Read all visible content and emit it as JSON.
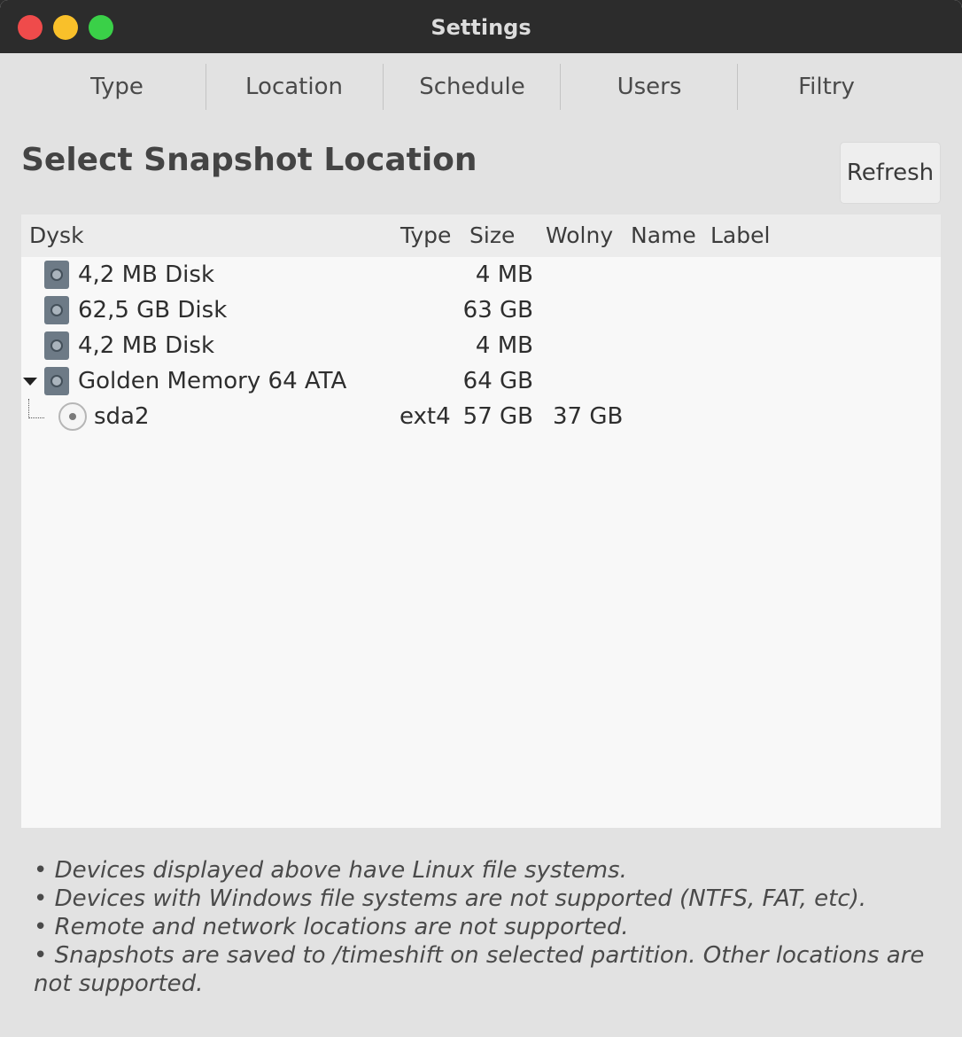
{
  "window": {
    "title": "Settings"
  },
  "tabs": [
    {
      "label": "Type"
    },
    {
      "label": "Location"
    },
    {
      "label": "Schedule"
    },
    {
      "label": "Users"
    },
    {
      "label": "Filtry"
    }
  ],
  "heading": "Select Snapshot Location",
  "refresh_label": "Refresh",
  "table": {
    "columns": {
      "disk": "Dysk",
      "type": "Type",
      "size": "Size",
      "free": "Wolny",
      "name": "Name",
      "label": "Label"
    },
    "rows": [
      {
        "disk": "4,2 MB Disk",
        "type": "",
        "size": "4 MB",
        "free": "",
        "icon": "drive-icon"
      },
      {
        "disk": "62,5 GB Disk",
        "type": "",
        "size": "63 GB",
        "free": "",
        "icon": "drive-icon"
      },
      {
        "disk": "4,2 MB Disk",
        "type": "",
        "size": "4 MB",
        "free": "",
        "icon": "drive-icon"
      },
      {
        "disk": "Golden Memory 64 ATA",
        "type": "",
        "size": "64 GB",
        "free": "",
        "icon": "drive-icon",
        "expanded": true
      },
      {
        "disk": "sda2",
        "type": "ext4",
        "size": "57 GB",
        "free": "37 GB",
        "icon": "radio-button",
        "selected": false
      }
    ]
  },
  "notes": [
    "• Devices displayed above have Linux file systems.",
    "• Devices with Windows file systems are not supported (NTFS, FAT, etc).",
    "• Remote and network locations are not supported.",
    "• Snapshots are saved to /timeshift on selected partition. Other locations are not supported."
  ],
  "colors": {
    "titlebar": "#2c2c2c",
    "window_bg": "#e2e2e2",
    "close": "#ef4b4b",
    "minimize": "#f9c02a",
    "maximize": "#3ad048"
  }
}
